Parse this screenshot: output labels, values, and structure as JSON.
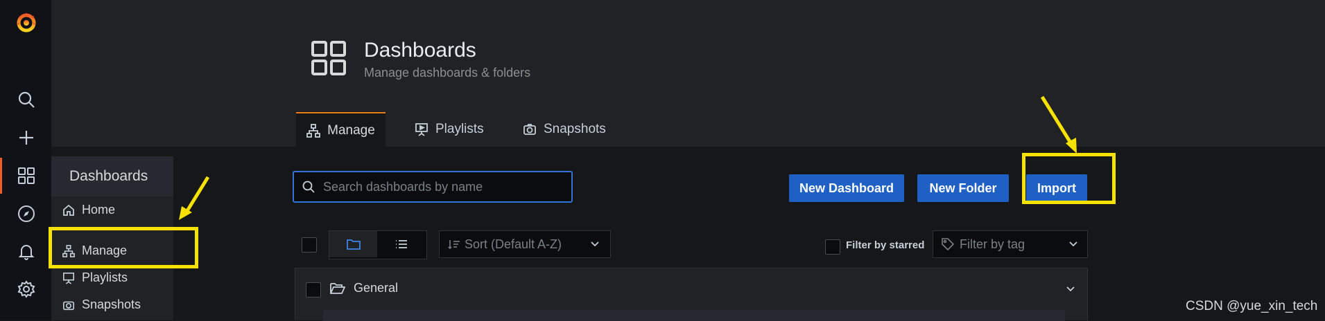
{
  "sidebar_rail": {
    "icons": [
      "grafana-logo",
      "search-icon",
      "plus-icon",
      "dashboards-icon",
      "compass-icon",
      "bell-icon",
      "gear-icon"
    ]
  },
  "page_header": {
    "title": "Dashboards",
    "subtitle": "Manage dashboards & folders"
  },
  "tabs": [
    {
      "label": "Manage",
      "active": true
    },
    {
      "label": "Playlists",
      "active": false
    },
    {
      "label": "Snapshots",
      "active": false
    }
  ],
  "popover_menu": {
    "title": "Dashboards",
    "items": [
      {
        "label": "Home"
      },
      {
        "label": "Manage"
      },
      {
        "label": "Playlists"
      },
      {
        "label": "Snapshots"
      }
    ]
  },
  "search": {
    "placeholder": "Search dashboards by name",
    "value": ""
  },
  "actions": {
    "new_dashboard": "New Dashboard",
    "new_folder": "New Folder",
    "import": "Import"
  },
  "filters": {
    "sort_placeholder": "Sort (Default A-Z)",
    "starred_label": "Filter by starred",
    "tag_placeholder": "Filter by tag"
  },
  "folders": [
    {
      "name": "General"
    }
  ],
  "watermark": "CSDN @yue_xin_tech",
  "colors": {
    "accent_orange": "#eb7b18",
    "primary_blue": "#1f60c4",
    "highlight_yellow": "#f6e100"
  }
}
